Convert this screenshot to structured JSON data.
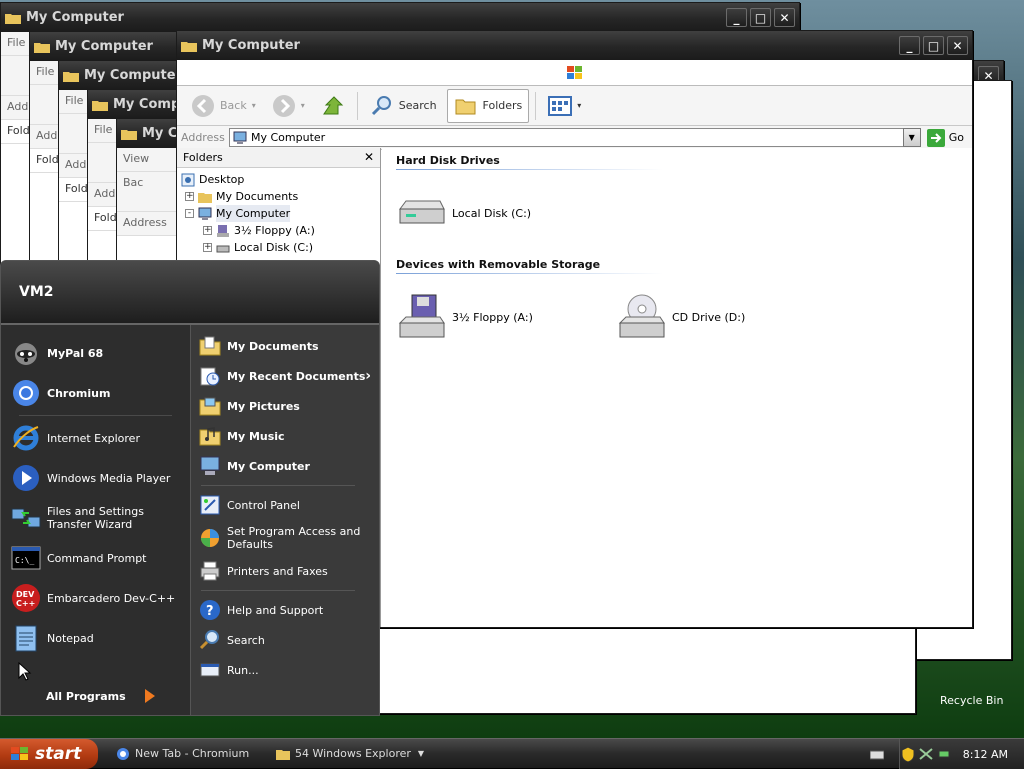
{
  "background_windows": [
    {
      "title": "My Computer",
      "rows": [
        "File",
        "",
        "Add",
        "Fold"
      ]
    },
    {
      "title": "My Computer",
      "rows": [
        "File",
        "",
        "Add",
        "Fold"
      ]
    },
    {
      "title": "My Computer",
      "rows": [
        "File",
        "",
        "Add",
        "Fold"
      ]
    },
    {
      "title": "My Compu",
      "rows": [
        "File",
        "",
        "Add",
        "Fold"
      ]
    },
    {
      "title": "My Co",
      "rows": [
        "View",
        "Bac",
        "Address"
      ]
    }
  ],
  "main_window": {
    "title": "My Computer",
    "toolbar": {
      "back": "Back",
      "search": "Search",
      "folders": "Folders"
    },
    "address": {
      "label": "Address",
      "value": "My Computer",
      "go": "Go"
    },
    "folders_panel": {
      "title": "Folders",
      "tree": [
        {
          "label": "Desktop",
          "level": 0,
          "expander": ""
        },
        {
          "label": "My Documents",
          "level": 1,
          "expander": "+"
        },
        {
          "label": "My Computer",
          "level": 1,
          "expander": "-"
        },
        {
          "label": "3½ Floppy (A:)",
          "level": 2,
          "expander": "+"
        },
        {
          "label": "Local Disk (C:)",
          "level": 2,
          "expander": "+"
        }
      ]
    },
    "groups": [
      {
        "title": "Hard Disk Drives",
        "items": [
          {
            "label": "Local Disk (C:)",
            "icon": "hard-disk-icon"
          }
        ]
      },
      {
        "title": "Devices with Removable Storage",
        "items": [
          {
            "label": "3½ Floppy (A:)",
            "icon": "floppy-drive-icon"
          },
          {
            "label": "CD Drive (D:)",
            "icon": "cd-drive-icon"
          }
        ]
      }
    ]
  },
  "right_window": {
    "go": "Go"
  },
  "start_menu": {
    "user": "VM2",
    "pinned": [
      {
        "label": "MyPal 68",
        "icon": "mypal-icon"
      },
      {
        "label": "Chromium",
        "icon": "chromium-icon"
      }
    ],
    "recent": [
      {
        "label": "Internet Explorer",
        "icon": "ie-icon"
      },
      {
        "label": "Windows Media Player",
        "icon": "media-player-icon"
      },
      {
        "label": "Files and Settings Transfer Wizard",
        "icon": "transfer-wizard-icon"
      },
      {
        "label": "Command Prompt",
        "icon": "cmd-icon"
      },
      {
        "label": "Embarcadero Dev-C++",
        "icon": "devcpp-icon"
      },
      {
        "label": "Notepad",
        "icon": "notepad-icon"
      }
    ],
    "all_programs": "All Programs",
    "right_top": [
      {
        "label": "My Documents",
        "icon": "folder-docs-icon"
      },
      {
        "label": "My Recent Documents",
        "icon": "recent-docs-icon",
        "arrow": "›"
      },
      {
        "label": "My Pictures",
        "icon": "folder-pictures-icon"
      },
      {
        "label": "My Music",
        "icon": "folder-music-icon"
      },
      {
        "label": "My Computer",
        "icon": "my-computer-icon"
      }
    ],
    "right_mid": [
      {
        "label": "Control Panel",
        "icon": "control-panel-icon"
      },
      {
        "label": "Set Program Access and Defaults",
        "icon": "program-access-icon"
      },
      {
        "label": "Printers and Faxes",
        "icon": "printer-icon"
      }
    ],
    "right_bottom": [
      {
        "label": "Help and Support",
        "icon": "help-icon"
      },
      {
        "label": "Search",
        "icon": "search-icon"
      },
      {
        "label": "Run...",
        "icon": "run-icon"
      }
    ]
  },
  "desktop": {
    "recycle_bin": "Recycle Bin"
  },
  "taskbar": {
    "start": "start",
    "tasks": [
      {
        "label": "New Tab - Chromium",
        "icon": "chromium-icon"
      },
      {
        "label": "54 Windows Explorer",
        "icon": "folder-icon"
      }
    ],
    "clock": "8:12 AM"
  },
  "colors": {
    "start_button": "#b23b12",
    "titlebar": "#262626",
    "selection": "#e6eaf2"
  }
}
